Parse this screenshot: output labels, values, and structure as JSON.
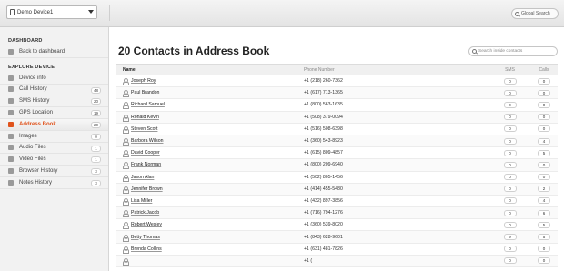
{
  "topbar": {
    "device": "Demo Device1",
    "global_search": "Global Search"
  },
  "sidebar": {
    "dashboard_header": "DASHBOARD",
    "back_label": "Back to dashboard",
    "explore_header": "EXPLORE DEVICE",
    "items": [
      {
        "label": "Device info",
        "count": ""
      },
      {
        "label": "Call History",
        "count": "48"
      },
      {
        "label": "SMS History",
        "count": "20"
      },
      {
        "label": "GPS Location",
        "count": "19"
      },
      {
        "label": "Address Book",
        "count": "20"
      },
      {
        "label": "Images",
        "count": "0"
      },
      {
        "label": "Audio Files",
        "count": "1"
      },
      {
        "label": "Video Files",
        "count": "1"
      },
      {
        "label": "Browser History",
        "count": "3"
      },
      {
        "label": "Notes History",
        "count": "3"
      }
    ]
  },
  "main": {
    "title": "20 Contacts in Address Book",
    "search_placeholder": "Search inside contacts",
    "columns": {
      "name": "Name",
      "phone": "Phone Number",
      "sms": "SMS",
      "calls": "Calls"
    },
    "rows": [
      {
        "name": "Joseph Roy",
        "phone": "+1 (218) 260-7362",
        "sms": "0",
        "calls": "0"
      },
      {
        "name": "Paul Brandon",
        "phone": "+1 (617) 713-1365",
        "sms": "0",
        "calls": "0"
      },
      {
        "name": "Richard Samuel",
        "phone": "+1 (800) 563-1635",
        "sms": "0",
        "calls": "0"
      },
      {
        "name": "Ronald Kevin",
        "phone": "+1 (508) 379-0094",
        "sms": "0",
        "calls": "0"
      },
      {
        "name": "Steven Scott",
        "phone": "+1 (516) 508-6398",
        "sms": "0",
        "calls": "0"
      },
      {
        "name": "Barbora Wilson",
        "phone": "+1 (360) 543-8923",
        "sms": "0",
        "calls": "4"
      },
      {
        "name": "David Cooper",
        "phone": "+1 (615) 809-4857",
        "sms": "0",
        "calls": "5"
      },
      {
        "name": "Frank Norman",
        "phone": "+1 (800) 209-6940",
        "sms": "0",
        "calls": "0"
      },
      {
        "name": "Jason Alan",
        "phone": "+1 (502) 805-1456",
        "sms": "0",
        "calls": "0"
      },
      {
        "name": "Jennifer Brown",
        "phone": "+1 (414) 455-5480",
        "sms": "0",
        "calls": "2"
      },
      {
        "name": "Lisa Miller",
        "phone": "+1 (432) 897-3856",
        "sms": "0",
        "calls": "4"
      },
      {
        "name": "Patrick Jacob",
        "phone": "+1 (716) 794-1276",
        "sms": "0",
        "calls": "6"
      },
      {
        "name": "Robert Wesley",
        "phone": "+1 (360) 539-8020",
        "sms": "0",
        "calls": "5"
      },
      {
        "name": "Betty Thomas",
        "phone": "+1 (843) 628-9601",
        "sms": "9",
        "calls": "5"
      },
      {
        "name": "Brenda Collins",
        "phone": "+1 (631) 481-7826",
        "sms": "0",
        "calls": "0"
      },
      {
        "name": "",
        "phone": "+1 (",
        "sms": "0",
        "calls": "0"
      }
    ]
  }
}
